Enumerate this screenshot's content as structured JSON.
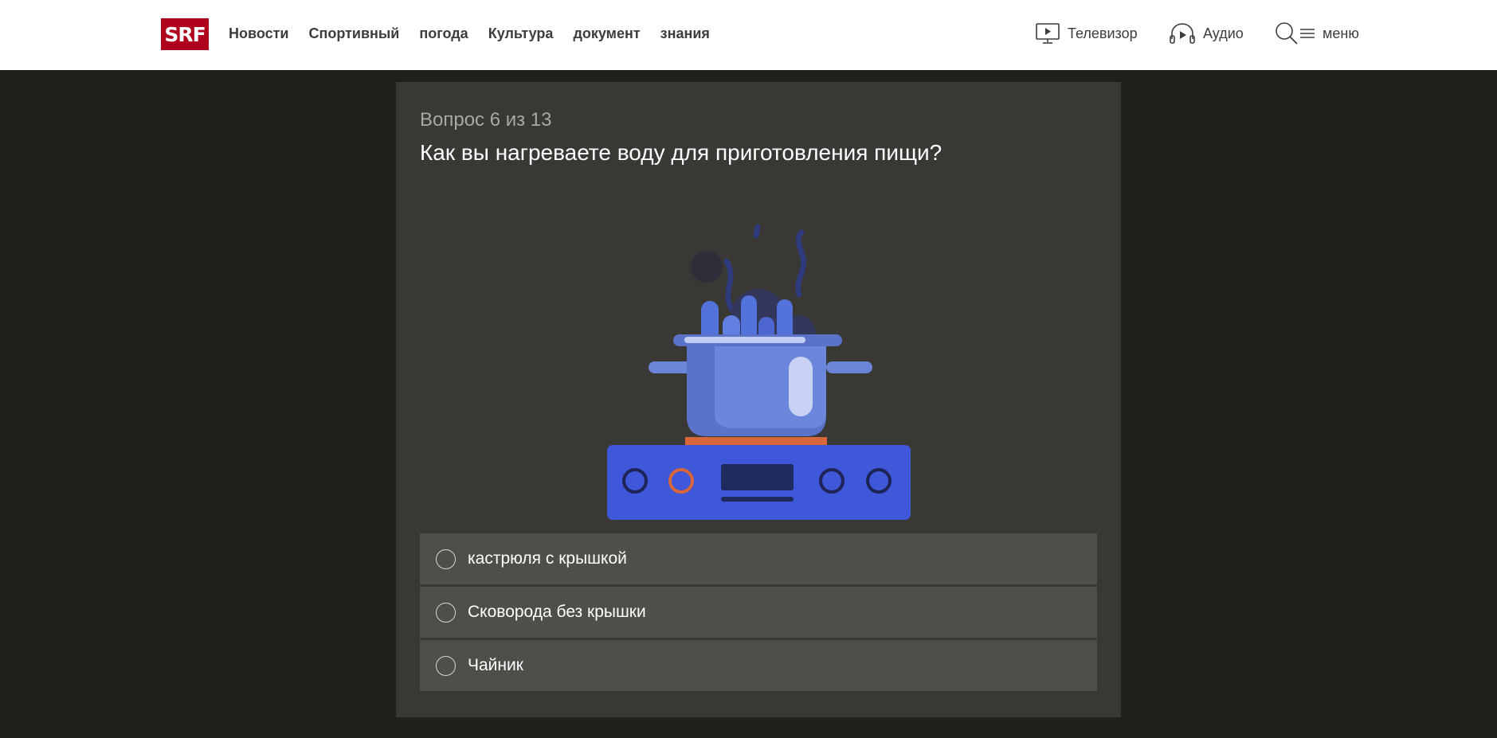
{
  "header": {
    "logo": "SRF",
    "nav": [
      "Новости",
      "Спортивный",
      "погода",
      "Культура",
      "документ",
      "знания"
    ],
    "tv_label": "Телевизор",
    "audio_label": "Аудио",
    "menu_label": "меню"
  },
  "quiz": {
    "counter": "Вопрос 6 из 13",
    "question": "Как вы нагреваете воду для приготовления пищи?",
    "illustration_icon": "boiling-pot-on-stove-icon",
    "answers": [
      "кастрюля с крышкой",
      "Сковорода без крышки",
      "Чайник"
    ]
  },
  "colors": {
    "brand_red": "#af001d",
    "page_bg": "#21201c",
    "card_bg": "#393834",
    "answer_bg": "#4f4e49",
    "stove_blue": "#3f57d9",
    "pot_blue": "#6a85d8",
    "accent_orange": "#d8663b"
  }
}
